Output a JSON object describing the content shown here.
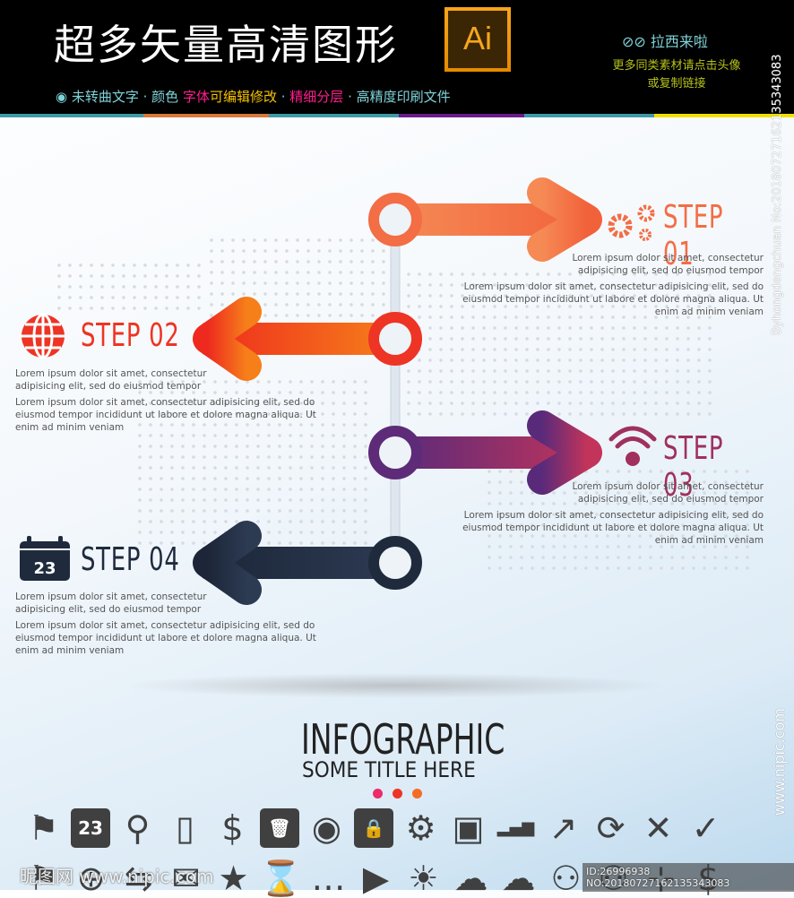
{
  "header": {
    "title": "超多矢量高清图形",
    "ai_badge": "Ai",
    "features": {
      "a": "未转曲文字 · 颜色 ",
      "b": "字体",
      "c": "可编辑修改",
      "d": " · ",
      "e": "精细分层",
      "f": " · 高精度印刷文件"
    },
    "brand": "拉西来啦",
    "more_line1": "更多同类素材请点击头像",
    "more_line2": "或复制链接",
    "stripe_colors": [
      "#3e9aa6",
      "#d8783a",
      "#3e9aa6",
      "#6a1a8c",
      "#3e9aa6",
      "#f0e000"
    ]
  },
  "steps": [
    {
      "label": "STEP 01",
      "icon": "gears-icon",
      "color": "#f36d45",
      "short": [
        "Lorem ipsum dolor sit amet, consectetur",
        "adipisicing elit, sed do eiusmod tempor"
      ],
      "long": [
        "Lorem ipsum dolor sit amet, consectetur adipisicing elit, sed do",
        "eiusmod tempor incididunt ut labore et dolore magna aliqua. Ut",
        "enim ad minim veniam"
      ]
    },
    {
      "label": "STEP 02",
      "icon": "globe-icon",
      "color": "#ee3424",
      "short": [
        "Lorem ipsum dolor sit amet, consectetur",
        "adipisicing elit, sed do eiusmod tempor"
      ],
      "long": [
        "Lorem ipsum dolor sit amet, consectetur adipisicing elit, sed do",
        "eiusmod tempor incididunt ut labore et dolore magna aliqua. Ut",
        "enim ad minim veniam"
      ]
    },
    {
      "label": "STEP 03",
      "icon": "wifi-icon",
      "color": "#a0305e",
      "short": [
        "Lorem ipsum dolor sit amet, consectetur",
        "adipisicing elit, sed do eiusmod tempor"
      ],
      "long": [
        "Lorem ipsum dolor sit amet, consectetur adipisicing elit, sed do",
        "eiusmod tempor incididunt ut labore et dolore magna aliqua. Ut",
        "enim ad minim veniam"
      ]
    },
    {
      "label": "STEP 04",
      "icon": "calendar-icon",
      "calendar_day": "23",
      "color": "#1f2b3d",
      "short": [
        "Lorem ipsum dolor sit amet, consectetur",
        "adipisicing elit, sed do eiusmod tempor"
      ],
      "long": [
        "Lorem ipsum dolor sit amet, consectetur adipisicing elit, sed do",
        "eiusmod tempor incididunt ut labore et dolore magna aliqua. Ut",
        "enim ad minim veniam"
      ]
    }
  ],
  "footer": {
    "title": "INFOGRAPHIC",
    "subtitle": "SOME TITLE  HERE",
    "dot_colors": [
      "#ee2a6a",
      "#ee3424",
      "#f36d25"
    ]
  },
  "icons_row1": [
    "⚑",
    "23",
    "⚲",
    "▯",
    "$",
    "🗑",
    "◉",
    "🔒",
    "⚙",
    "▣",
    "▂▄▆",
    "↗",
    "⟳",
    "✕",
    "✓"
  ],
  "icons_row1_names": [
    "flag",
    "calendar",
    "search",
    "phone",
    "dollar",
    "trash",
    "wifi",
    "lock",
    "gears",
    "briefcase",
    "signal",
    "trend",
    "refresh",
    "close",
    "check"
  ],
  "icons_row2": [
    "⚑",
    "⊕",
    "⇆",
    "✉",
    "★",
    "⌛",
    "…",
    "▶",
    "☀",
    "☁",
    "☁",
    "⚇",
    "⚇",
    "⊹",
    "$"
  ],
  "watermarks": {
    "site": "昵图网 www.nipic.com",
    "id": "ID:26996938 NO:20180727162135343083",
    "vertical_top": "Byhongdengchuan No:20180727162135343083",
    "vertical_bottom": "www.nipic.com"
  }
}
